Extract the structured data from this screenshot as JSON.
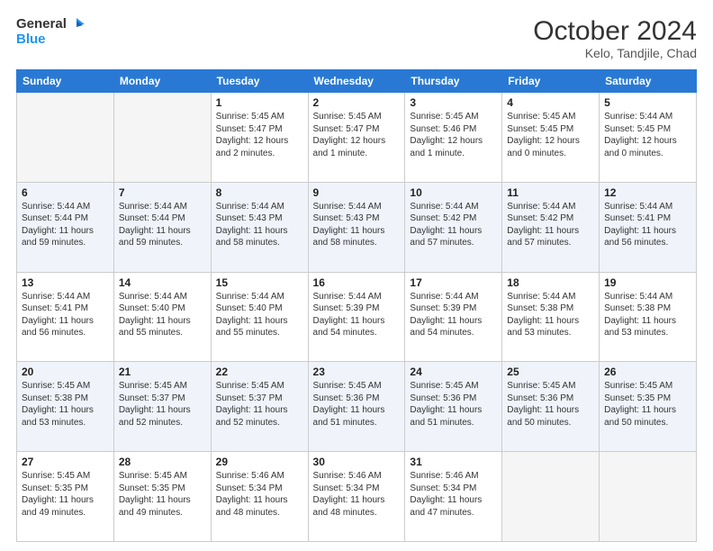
{
  "header": {
    "logo_line1": "General",
    "logo_line2": "Blue",
    "main_title": "October 2024",
    "subtitle": "Kelo, Tandjile, Chad"
  },
  "calendar": {
    "days_of_week": [
      "Sunday",
      "Monday",
      "Tuesday",
      "Wednesday",
      "Thursday",
      "Friday",
      "Saturday"
    ],
    "rows": [
      [
        {
          "day": "",
          "empty": true
        },
        {
          "day": "",
          "empty": true
        },
        {
          "day": "1",
          "sunrise": "Sunrise: 5:45 AM",
          "sunset": "Sunset: 5:47 PM",
          "daylight": "Daylight: 12 hours and 2 minutes."
        },
        {
          "day": "2",
          "sunrise": "Sunrise: 5:45 AM",
          "sunset": "Sunset: 5:47 PM",
          "daylight": "Daylight: 12 hours and 1 minute."
        },
        {
          "day": "3",
          "sunrise": "Sunrise: 5:45 AM",
          "sunset": "Sunset: 5:46 PM",
          "daylight": "Daylight: 12 hours and 1 minute."
        },
        {
          "day": "4",
          "sunrise": "Sunrise: 5:45 AM",
          "sunset": "Sunset: 5:45 PM",
          "daylight": "Daylight: 12 hours and 0 minutes."
        },
        {
          "day": "5",
          "sunrise": "Sunrise: 5:44 AM",
          "sunset": "Sunset: 5:45 PM",
          "daylight": "Daylight: 12 hours and 0 minutes."
        }
      ],
      [
        {
          "day": "6",
          "sunrise": "Sunrise: 5:44 AM",
          "sunset": "Sunset: 5:44 PM",
          "daylight": "Daylight: 11 hours and 59 minutes."
        },
        {
          "day": "7",
          "sunrise": "Sunrise: 5:44 AM",
          "sunset": "Sunset: 5:44 PM",
          "daylight": "Daylight: 11 hours and 59 minutes."
        },
        {
          "day": "8",
          "sunrise": "Sunrise: 5:44 AM",
          "sunset": "Sunset: 5:43 PM",
          "daylight": "Daylight: 11 hours and 58 minutes."
        },
        {
          "day": "9",
          "sunrise": "Sunrise: 5:44 AM",
          "sunset": "Sunset: 5:43 PM",
          "daylight": "Daylight: 11 hours and 58 minutes."
        },
        {
          "day": "10",
          "sunrise": "Sunrise: 5:44 AM",
          "sunset": "Sunset: 5:42 PM",
          "daylight": "Daylight: 11 hours and 57 minutes."
        },
        {
          "day": "11",
          "sunrise": "Sunrise: 5:44 AM",
          "sunset": "Sunset: 5:42 PM",
          "daylight": "Daylight: 11 hours and 57 minutes."
        },
        {
          "day": "12",
          "sunrise": "Sunrise: 5:44 AM",
          "sunset": "Sunset: 5:41 PM",
          "daylight": "Daylight: 11 hours and 56 minutes."
        }
      ],
      [
        {
          "day": "13",
          "sunrise": "Sunrise: 5:44 AM",
          "sunset": "Sunset: 5:41 PM",
          "daylight": "Daylight: 11 hours and 56 minutes."
        },
        {
          "day": "14",
          "sunrise": "Sunrise: 5:44 AM",
          "sunset": "Sunset: 5:40 PM",
          "daylight": "Daylight: 11 hours and 55 minutes."
        },
        {
          "day": "15",
          "sunrise": "Sunrise: 5:44 AM",
          "sunset": "Sunset: 5:40 PM",
          "daylight": "Daylight: 11 hours and 55 minutes."
        },
        {
          "day": "16",
          "sunrise": "Sunrise: 5:44 AM",
          "sunset": "Sunset: 5:39 PM",
          "daylight": "Daylight: 11 hours and 54 minutes."
        },
        {
          "day": "17",
          "sunrise": "Sunrise: 5:44 AM",
          "sunset": "Sunset: 5:39 PM",
          "daylight": "Daylight: 11 hours and 54 minutes."
        },
        {
          "day": "18",
          "sunrise": "Sunrise: 5:44 AM",
          "sunset": "Sunset: 5:38 PM",
          "daylight": "Daylight: 11 hours and 53 minutes."
        },
        {
          "day": "19",
          "sunrise": "Sunrise: 5:44 AM",
          "sunset": "Sunset: 5:38 PM",
          "daylight": "Daylight: 11 hours and 53 minutes."
        }
      ],
      [
        {
          "day": "20",
          "sunrise": "Sunrise: 5:45 AM",
          "sunset": "Sunset: 5:38 PM",
          "daylight": "Daylight: 11 hours and 53 minutes."
        },
        {
          "day": "21",
          "sunrise": "Sunrise: 5:45 AM",
          "sunset": "Sunset: 5:37 PM",
          "daylight": "Daylight: 11 hours and 52 minutes."
        },
        {
          "day": "22",
          "sunrise": "Sunrise: 5:45 AM",
          "sunset": "Sunset: 5:37 PM",
          "daylight": "Daylight: 11 hours and 52 minutes."
        },
        {
          "day": "23",
          "sunrise": "Sunrise: 5:45 AM",
          "sunset": "Sunset: 5:36 PM",
          "daylight": "Daylight: 11 hours and 51 minutes."
        },
        {
          "day": "24",
          "sunrise": "Sunrise: 5:45 AM",
          "sunset": "Sunset: 5:36 PM",
          "daylight": "Daylight: 11 hours and 51 minutes."
        },
        {
          "day": "25",
          "sunrise": "Sunrise: 5:45 AM",
          "sunset": "Sunset: 5:36 PM",
          "daylight": "Daylight: 11 hours and 50 minutes."
        },
        {
          "day": "26",
          "sunrise": "Sunrise: 5:45 AM",
          "sunset": "Sunset: 5:35 PM",
          "daylight": "Daylight: 11 hours and 50 minutes."
        }
      ],
      [
        {
          "day": "27",
          "sunrise": "Sunrise: 5:45 AM",
          "sunset": "Sunset: 5:35 PM",
          "daylight": "Daylight: 11 hours and 49 minutes."
        },
        {
          "day": "28",
          "sunrise": "Sunrise: 5:45 AM",
          "sunset": "Sunset: 5:35 PM",
          "daylight": "Daylight: 11 hours and 49 minutes."
        },
        {
          "day": "29",
          "sunrise": "Sunrise: 5:46 AM",
          "sunset": "Sunset: 5:34 PM",
          "daylight": "Daylight: 11 hours and 48 minutes."
        },
        {
          "day": "30",
          "sunrise": "Sunrise: 5:46 AM",
          "sunset": "Sunset: 5:34 PM",
          "daylight": "Daylight: 11 hours and 48 minutes."
        },
        {
          "day": "31",
          "sunrise": "Sunrise: 5:46 AM",
          "sunset": "Sunset: 5:34 PM",
          "daylight": "Daylight: 11 hours and 47 minutes."
        },
        {
          "day": "",
          "empty": true
        },
        {
          "day": "",
          "empty": true
        }
      ]
    ]
  }
}
